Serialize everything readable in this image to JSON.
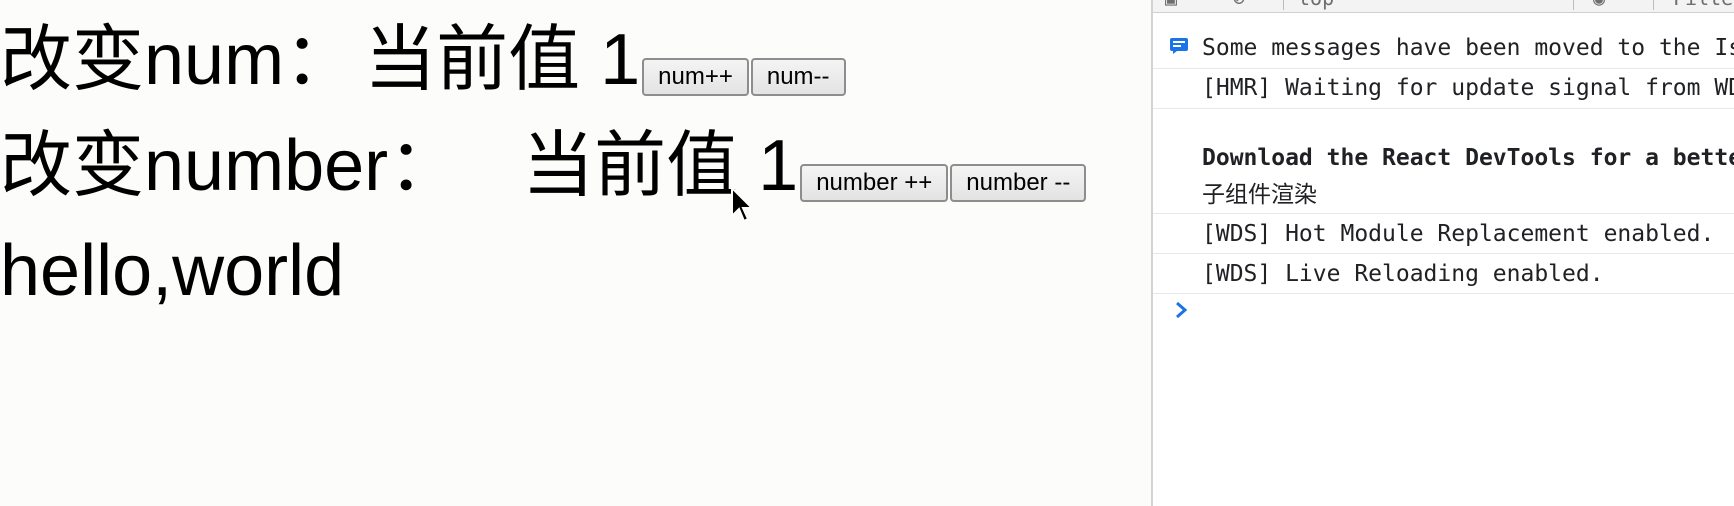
{
  "app": {
    "num_row": {
      "label": "改变num：",
      "current_text": "当前值 1",
      "inc_button": "num++",
      "dec_button": "num--"
    },
    "number_row": {
      "label": "改变number：",
      "current_text": "当前值 1",
      "inc_button": "number ++",
      "dec_button": "number --"
    },
    "greeting": "hello,world"
  },
  "devtools": {
    "toolbar": {
      "context": "top",
      "filter_placeholder": "Filter"
    },
    "console": {
      "messages": [
        "Some messages have been moved to the Issues panel.",
        "[HMR] Waiting for update signal from WDS...",
        "",
        "Download the React DevTools for a better development experience",
        "子组件渲染",
        "[WDS] Hot Module Replacement enabled.",
        "[WDS] Live Reloading enabled."
      ]
    },
    "colors": {
      "info_icon": "#1a73e8",
      "prompt": "#1a73e8"
    }
  }
}
